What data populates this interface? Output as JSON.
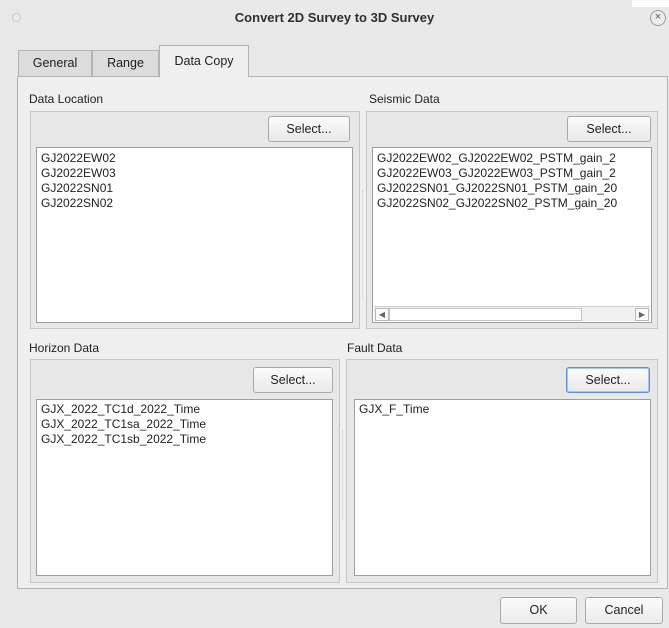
{
  "window": {
    "title": "Convert 2D Survey to 3D Survey",
    "close_glyph": "×"
  },
  "tabs": [
    {
      "label": "General",
      "active": false
    },
    {
      "label": "Range",
      "active": false
    },
    {
      "label": "Data Copy",
      "active": true
    }
  ],
  "sections": {
    "data_location": {
      "label": "Data Location",
      "select_label": "Select...",
      "items": [
        "GJ2022EW02",
        "GJ2022EW03",
        "GJ2022SN01",
        "GJ2022SN02"
      ]
    },
    "seismic_data": {
      "label": "Seismic Data",
      "select_label": "Select...",
      "items": [
        "GJ2022EW02_GJ2022EW02_PSTM_gain_2",
        "GJ2022EW03_GJ2022EW03_PSTM_gain_2",
        "GJ2022SN01_GJ2022SN01_PSTM_gain_20",
        "GJ2022SN02_GJ2022SN02_PSTM_gain_20"
      ],
      "scroll_left_glyph": "◀",
      "scroll_right_glyph": "▶"
    },
    "horizon_data": {
      "label": "Horizon Data",
      "select_label": "Select...",
      "items": [
        "GJX_2022_TC1d_2022_Time",
        "GJX_2022_TC1sa_2022_Time",
        "GJX_2022_TC1sb_2022_Time"
      ]
    },
    "fault_data": {
      "label": "Fault Data",
      "select_label": "Select...",
      "items": [
        "GJX_F_Time"
      ]
    }
  },
  "footer": {
    "ok_label": "OK",
    "cancel_label": "Cancel"
  },
  "colors": {
    "dialog_bg": "#e9e9e9",
    "panel_bg": "#efefef",
    "focus_border": "#5b8ed6"
  }
}
